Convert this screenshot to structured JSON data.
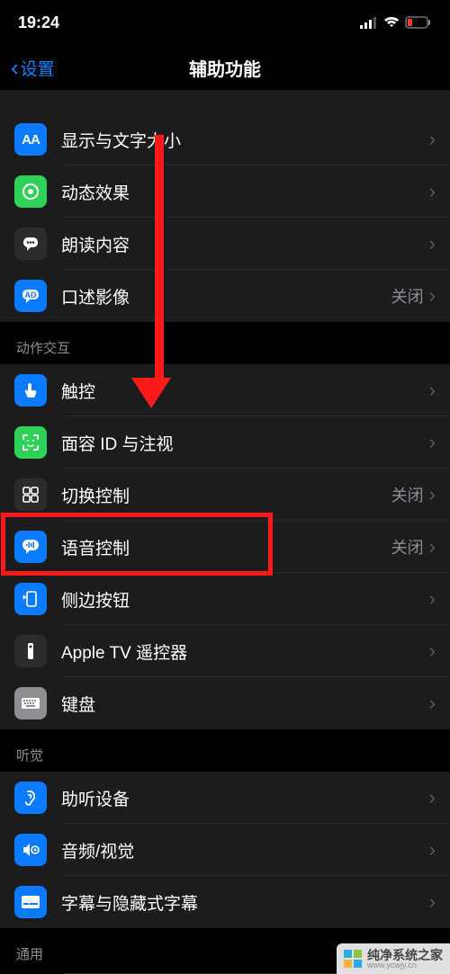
{
  "status_bar": {
    "time": "19:24"
  },
  "nav": {
    "back": "设置",
    "title": "辅助功能"
  },
  "groups": {
    "visual": [
      {
        "id": "display-text-size",
        "label": "显示与文字大小",
        "icon": "text-size",
        "color": "blue"
      },
      {
        "id": "motion",
        "label": "动态效果",
        "icon": "motion",
        "color": "green"
      },
      {
        "id": "spoken-content",
        "label": "朗读内容",
        "icon": "speech-bubble",
        "color": "darkgray"
      },
      {
        "id": "audio-descriptions",
        "label": "口述影像",
        "icon": "ad-bubble",
        "color": "blue",
        "value": "关闭"
      }
    ],
    "interaction_header": "动作交互",
    "interaction": [
      {
        "id": "touch",
        "label": "触控",
        "icon": "touch",
        "color": "blue"
      },
      {
        "id": "face-id",
        "label": "面容 ID 与注视",
        "icon": "face",
        "color": "green"
      },
      {
        "id": "switch-control",
        "label": "切换控制",
        "icon": "grid",
        "color": "darkgray",
        "value": "关闭"
      },
      {
        "id": "voice-control",
        "label": "语音控制",
        "icon": "voice-bubble",
        "color": "blue",
        "value": "关闭"
      },
      {
        "id": "side-button",
        "label": "侧边按钮",
        "icon": "side-button",
        "color": "blue"
      },
      {
        "id": "apple-tv-remote",
        "label": "Apple TV 遥控器",
        "icon": "remote",
        "color": "darkgray"
      },
      {
        "id": "keyboards",
        "label": "键盘",
        "icon": "keyboard",
        "color": "gray"
      }
    ],
    "hearing_header": "听觉",
    "hearing": [
      {
        "id": "hearing-devices",
        "label": "助听设备",
        "icon": "ear",
        "color": "blue"
      },
      {
        "id": "audio-visual",
        "label": "音频/视觉",
        "icon": "audio-visual",
        "color": "blue"
      },
      {
        "id": "subtitles",
        "label": "字幕与隐藏式字幕",
        "icon": "subtitles",
        "color": "blue"
      }
    ],
    "general_header": "通用"
  },
  "watermark": {
    "text": "纯净系统之家",
    "url": "www.ycwjy.cn"
  }
}
